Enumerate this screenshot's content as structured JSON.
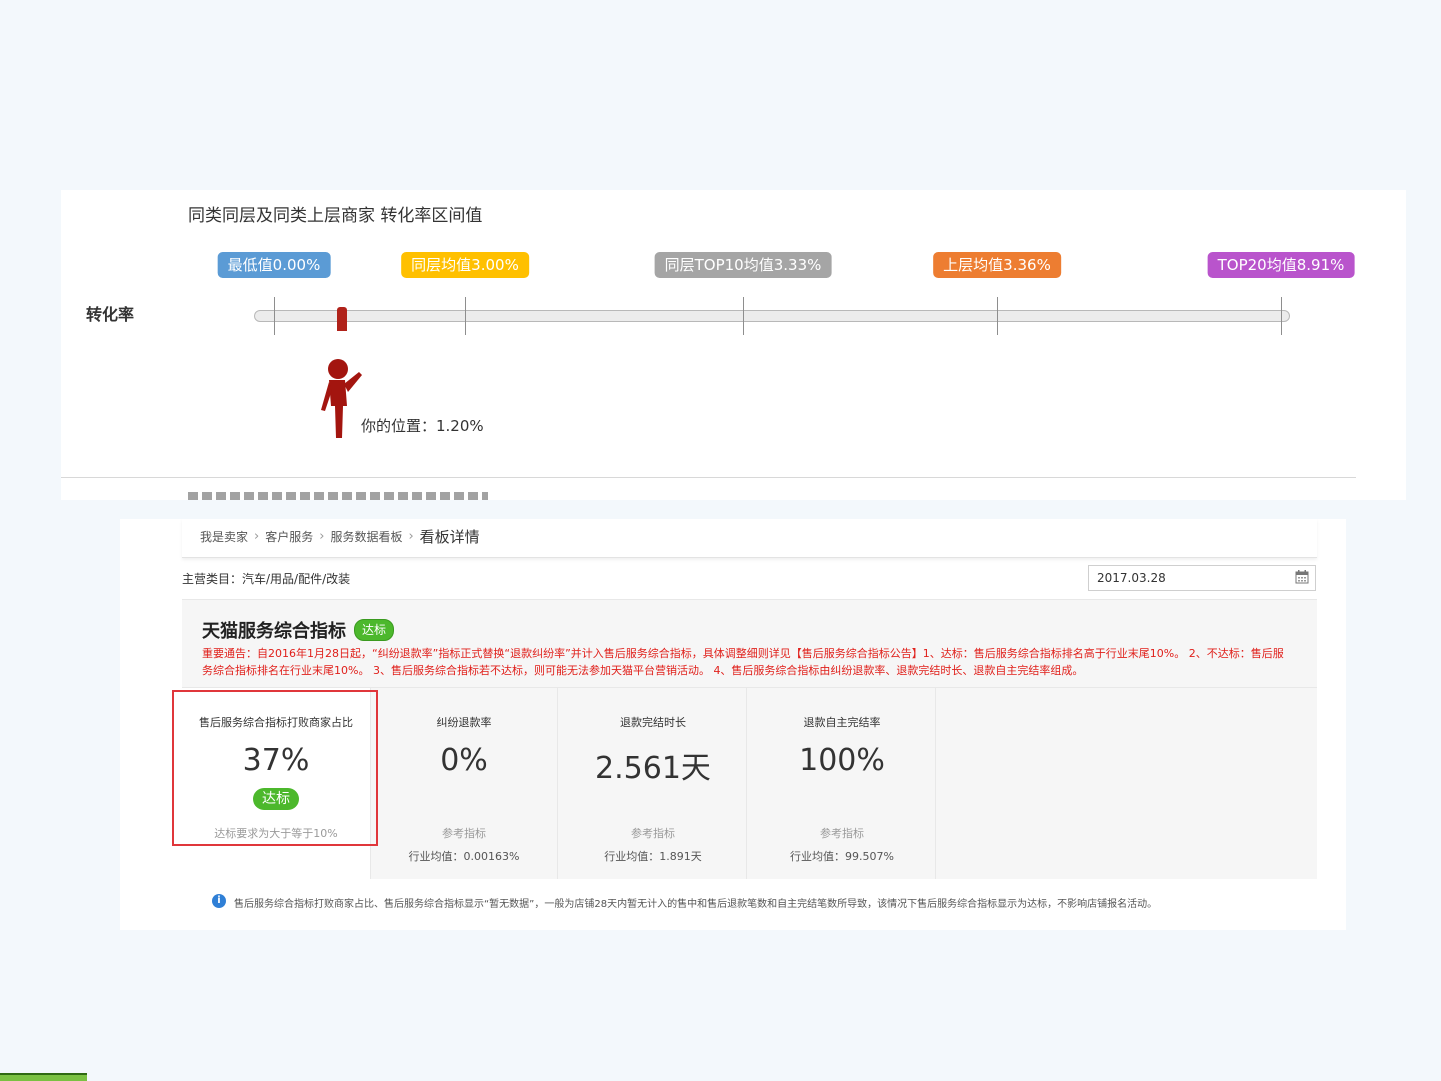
{
  "range_panel": {
    "title": "同类同层及同类上层商家 转化率区间值",
    "row_label": "转化率",
    "tags": [
      {
        "label": "最低值0.00%",
        "color": "#5b9bd5"
      },
      {
        "label": "同层均值3.00%",
        "color": "#ffc000"
      },
      {
        "label": "同层TOP10均值3.33%",
        "color": "#a5a5a5"
      },
      {
        "label": "上层均值3.36%",
        "color": "#ed7d31"
      },
      {
        "label": "TOP20均值8.91%",
        "color": "#b954cc"
      }
    ],
    "your_position": "你的位置：1.20%",
    "marker_color": "#b0221a"
  },
  "dashboard": {
    "breadcrumb": [
      "我是卖家",
      "客户服务",
      "服务数据看板",
      "看板详情"
    ],
    "category": "主营类目：汽车/用品/配件/改装",
    "date": "2017.03.28",
    "card_title": "天猫服务综合指标",
    "card_badge": "达标",
    "notice": "重要通告：自2016年1月28日起，“纠纷退款率”指标正式替换“退款纠纷率”并计入售后服务综合指标，具体调整细则详见【售后服务综合指标公告】1、达标：售后服务综合指标排名高于行业末尾10%。 2、不达标：售后服务综合指标排名在行业末尾10%。 3、售后服务综合指标若不达标，则可能无法参加天猫平台营销活动。 4、售后服务综合指标由纠纷退款率、退款完结时长、退款自主完结率组成。",
    "metrics": [
      {
        "title": "售后服务综合指标打败商家占比",
        "value": "37%",
        "badge": "达标",
        "sub1": "达标要求为大于等于10%"
      },
      {
        "title": "纠纷退款率",
        "value": "0%",
        "sub1": "参考指标",
        "sub2": "行业均值：0.00163%"
      },
      {
        "title": "退款完结时长",
        "value": "2.561天",
        "sub1": "参考指标",
        "sub2": "行业均值：1.891天"
      },
      {
        "title": "退款自主完结率",
        "value": "100%",
        "sub1": "参考指标",
        "sub2": "行业均值：99.507%"
      }
    ],
    "footer_note": "售后服务综合指标打败商家占比、售后服务综合指标显示“暂无数据”，一般为店铺28天内暂无计入的售中和售后退款笔数和自主完结笔数所导致，该情况下售后服务综合指标显示为达标，不影响店铺报名活动。",
    "accent_green": "#4cb82c",
    "highlight_red": "#e0363b"
  }
}
